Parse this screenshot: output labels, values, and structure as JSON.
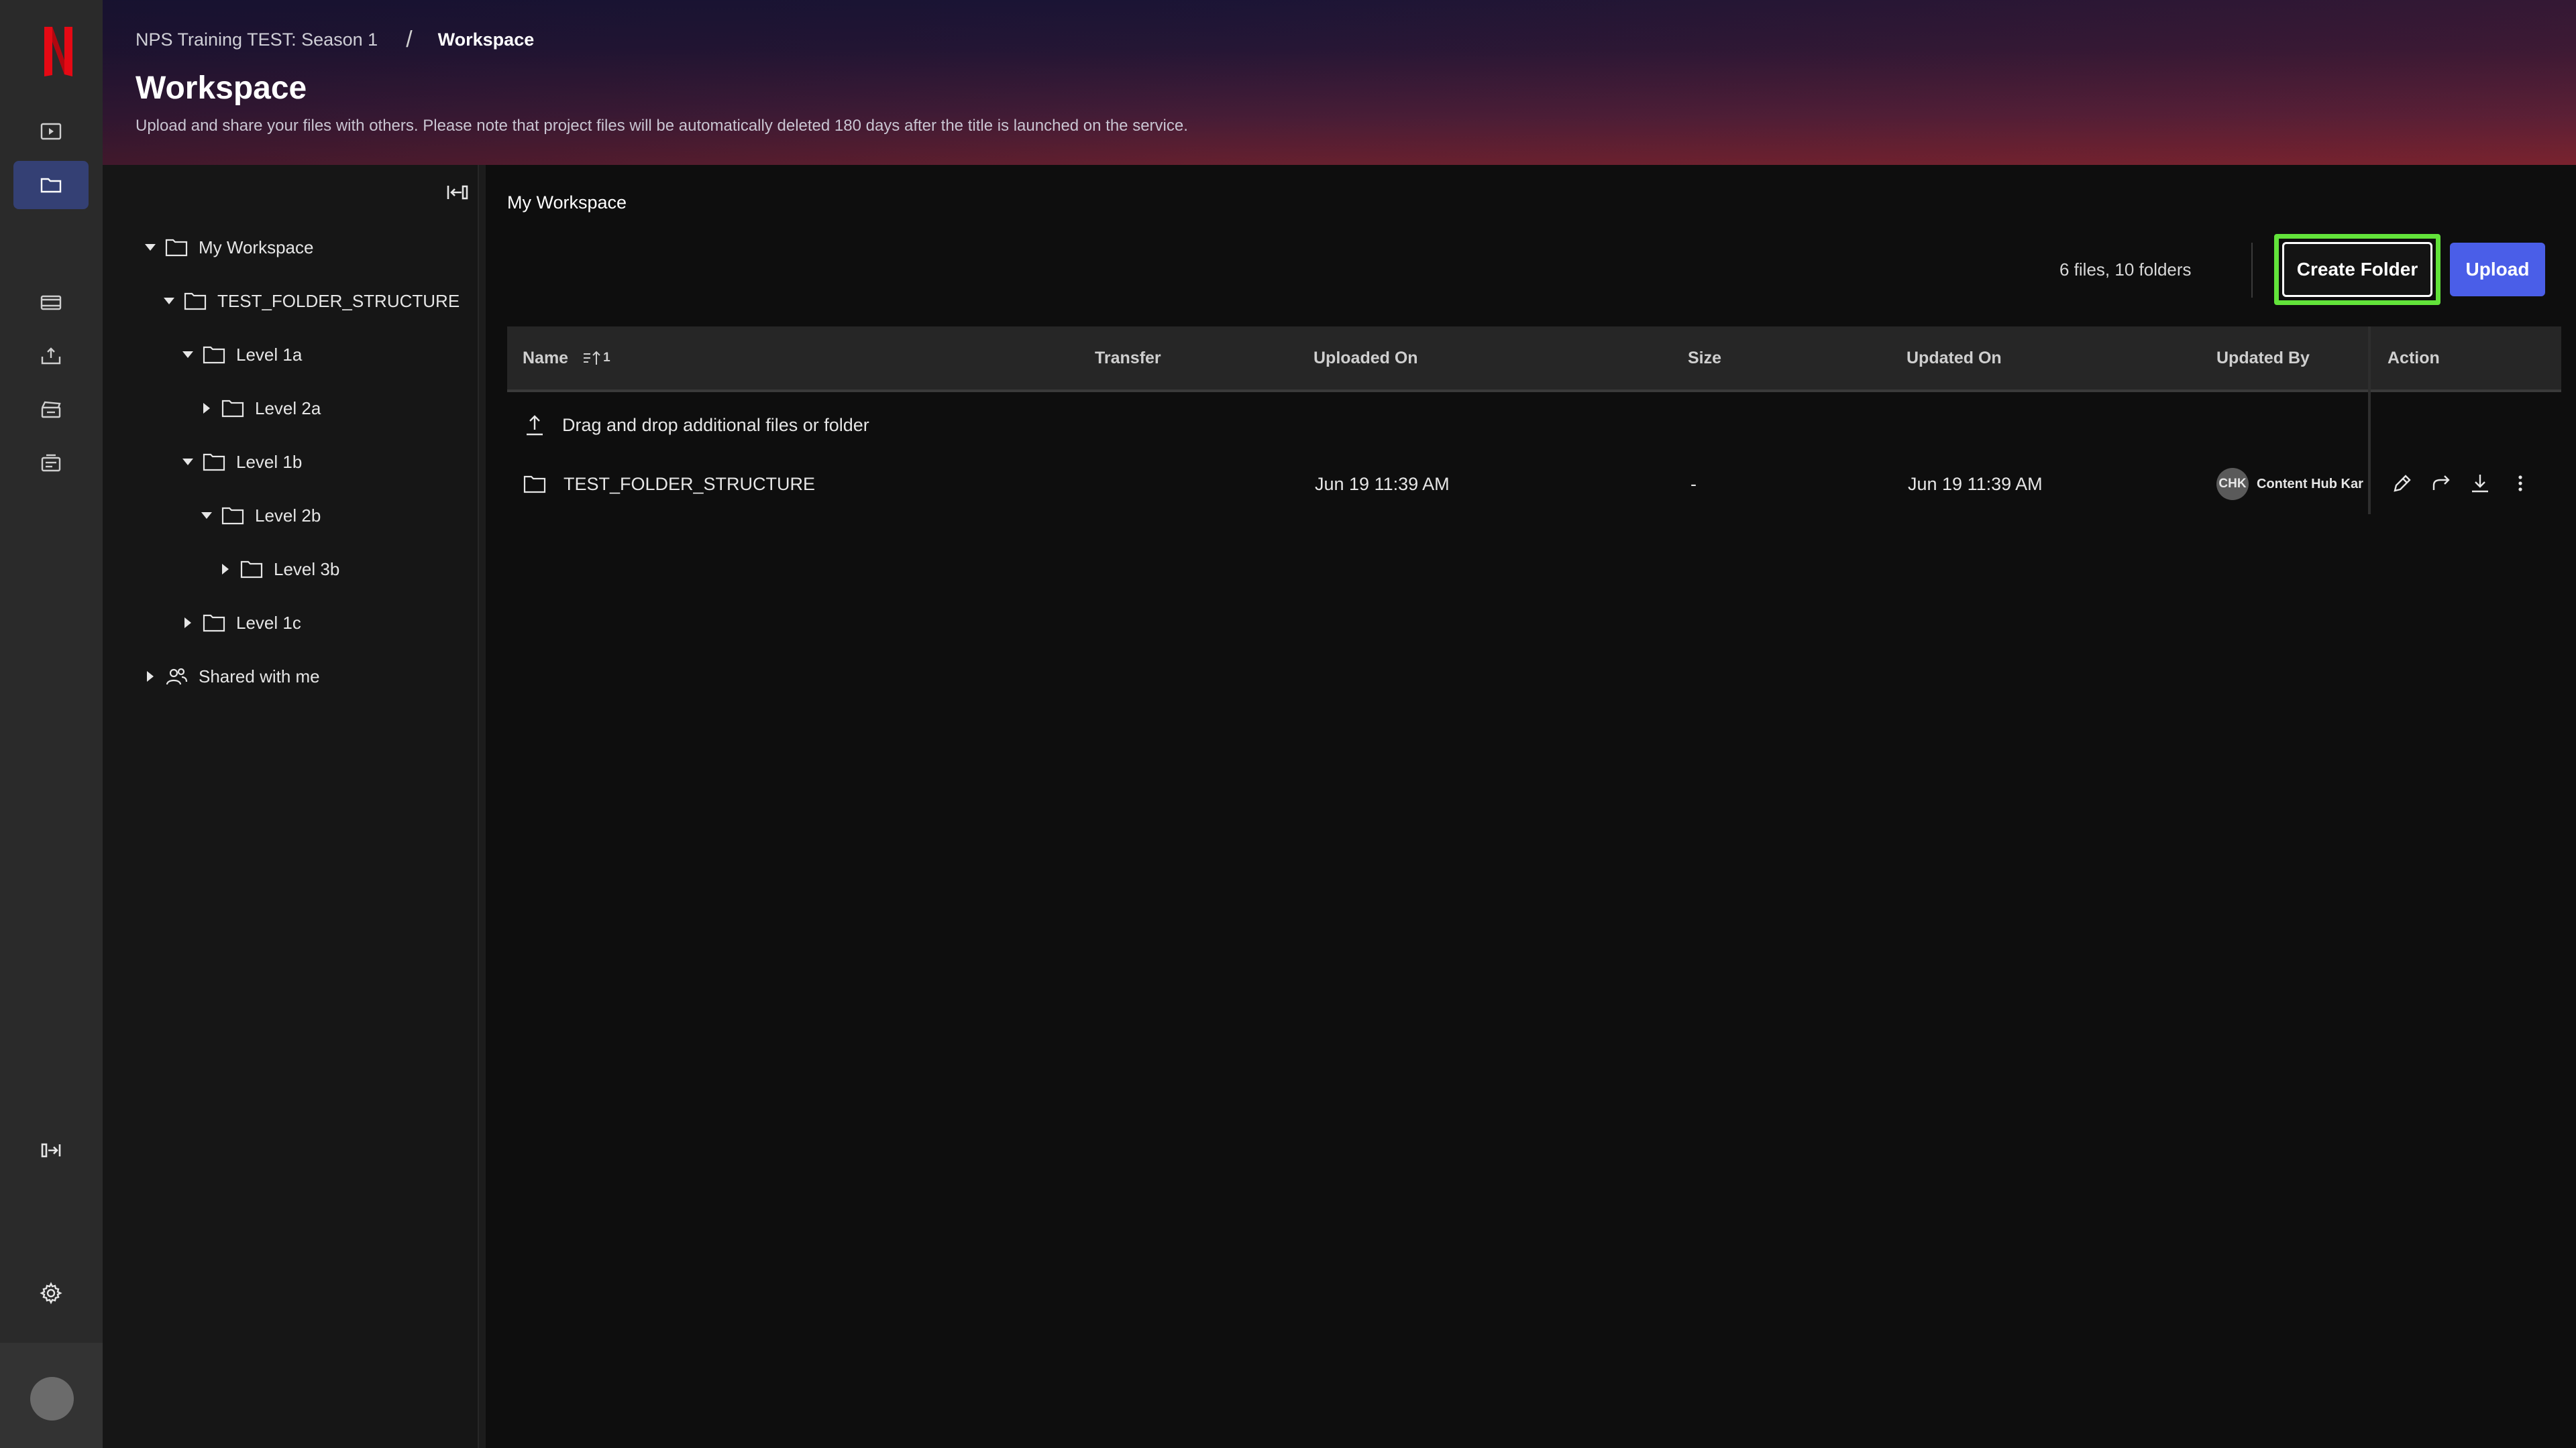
{
  "rail": {
    "logo_letter": "N",
    "items": [
      "play-icon",
      "folder-icon",
      "film-icon",
      "upload-tray-icon",
      "clapper-icon",
      "schedule-icon"
    ],
    "expand_icon": "expand-panel-icon",
    "settings_icon": "gear-icon"
  },
  "header": {
    "breadcrumb_parent": "NPS Training TEST: Season 1",
    "breadcrumb_separator": "/",
    "breadcrumb_current": "Workspace",
    "title": "Workspace",
    "description": "Upload and share your files with others. Please note that project files will be automatically deleted 180 days after the title is launched on the service."
  },
  "tree": {
    "items": [
      {
        "label": "My Workspace"
      },
      {
        "label": "TEST_FOLDER_STRUCTURE"
      },
      {
        "label": "Level 1a"
      },
      {
        "label": "Level 2a"
      },
      {
        "label": "Level 1b"
      },
      {
        "label": "Level 2b"
      },
      {
        "label": "Level 3b"
      },
      {
        "label": "Level 1c"
      },
      {
        "label": "Shared with me"
      }
    ]
  },
  "main": {
    "title": "My Workspace",
    "count": "6 files, 10 folders",
    "create_folder_label": "Create Folder",
    "upload_label": "Upload",
    "columns": {
      "name": "Name",
      "sort_indicator": "1",
      "transfer": "Transfer",
      "uploaded_on": "Uploaded On",
      "size": "Size",
      "updated_on": "Updated On",
      "updated_by": "Updated By",
      "action": "Action"
    },
    "drop_hint": "Drag and drop additional files or folder",
    "rows": [
      {
        "name": "TEST_FOLDER_STRUCTURE",
        "uploaded_on": "Jun 19 11:39 AM",
        "size": "-",
        "updated_on": "Jun 19 11:39 AM",
        "avatar_initials": "CHK",
        "updated_by": "Content Hub Kar"
      }
    ]
  },
  "colors": {
    "accent": "#4a5ee8",
    "focus_ring": "#62e33a",
    "rail_active": "#344074",
    "brand_red": "#e50914"
  }
}
